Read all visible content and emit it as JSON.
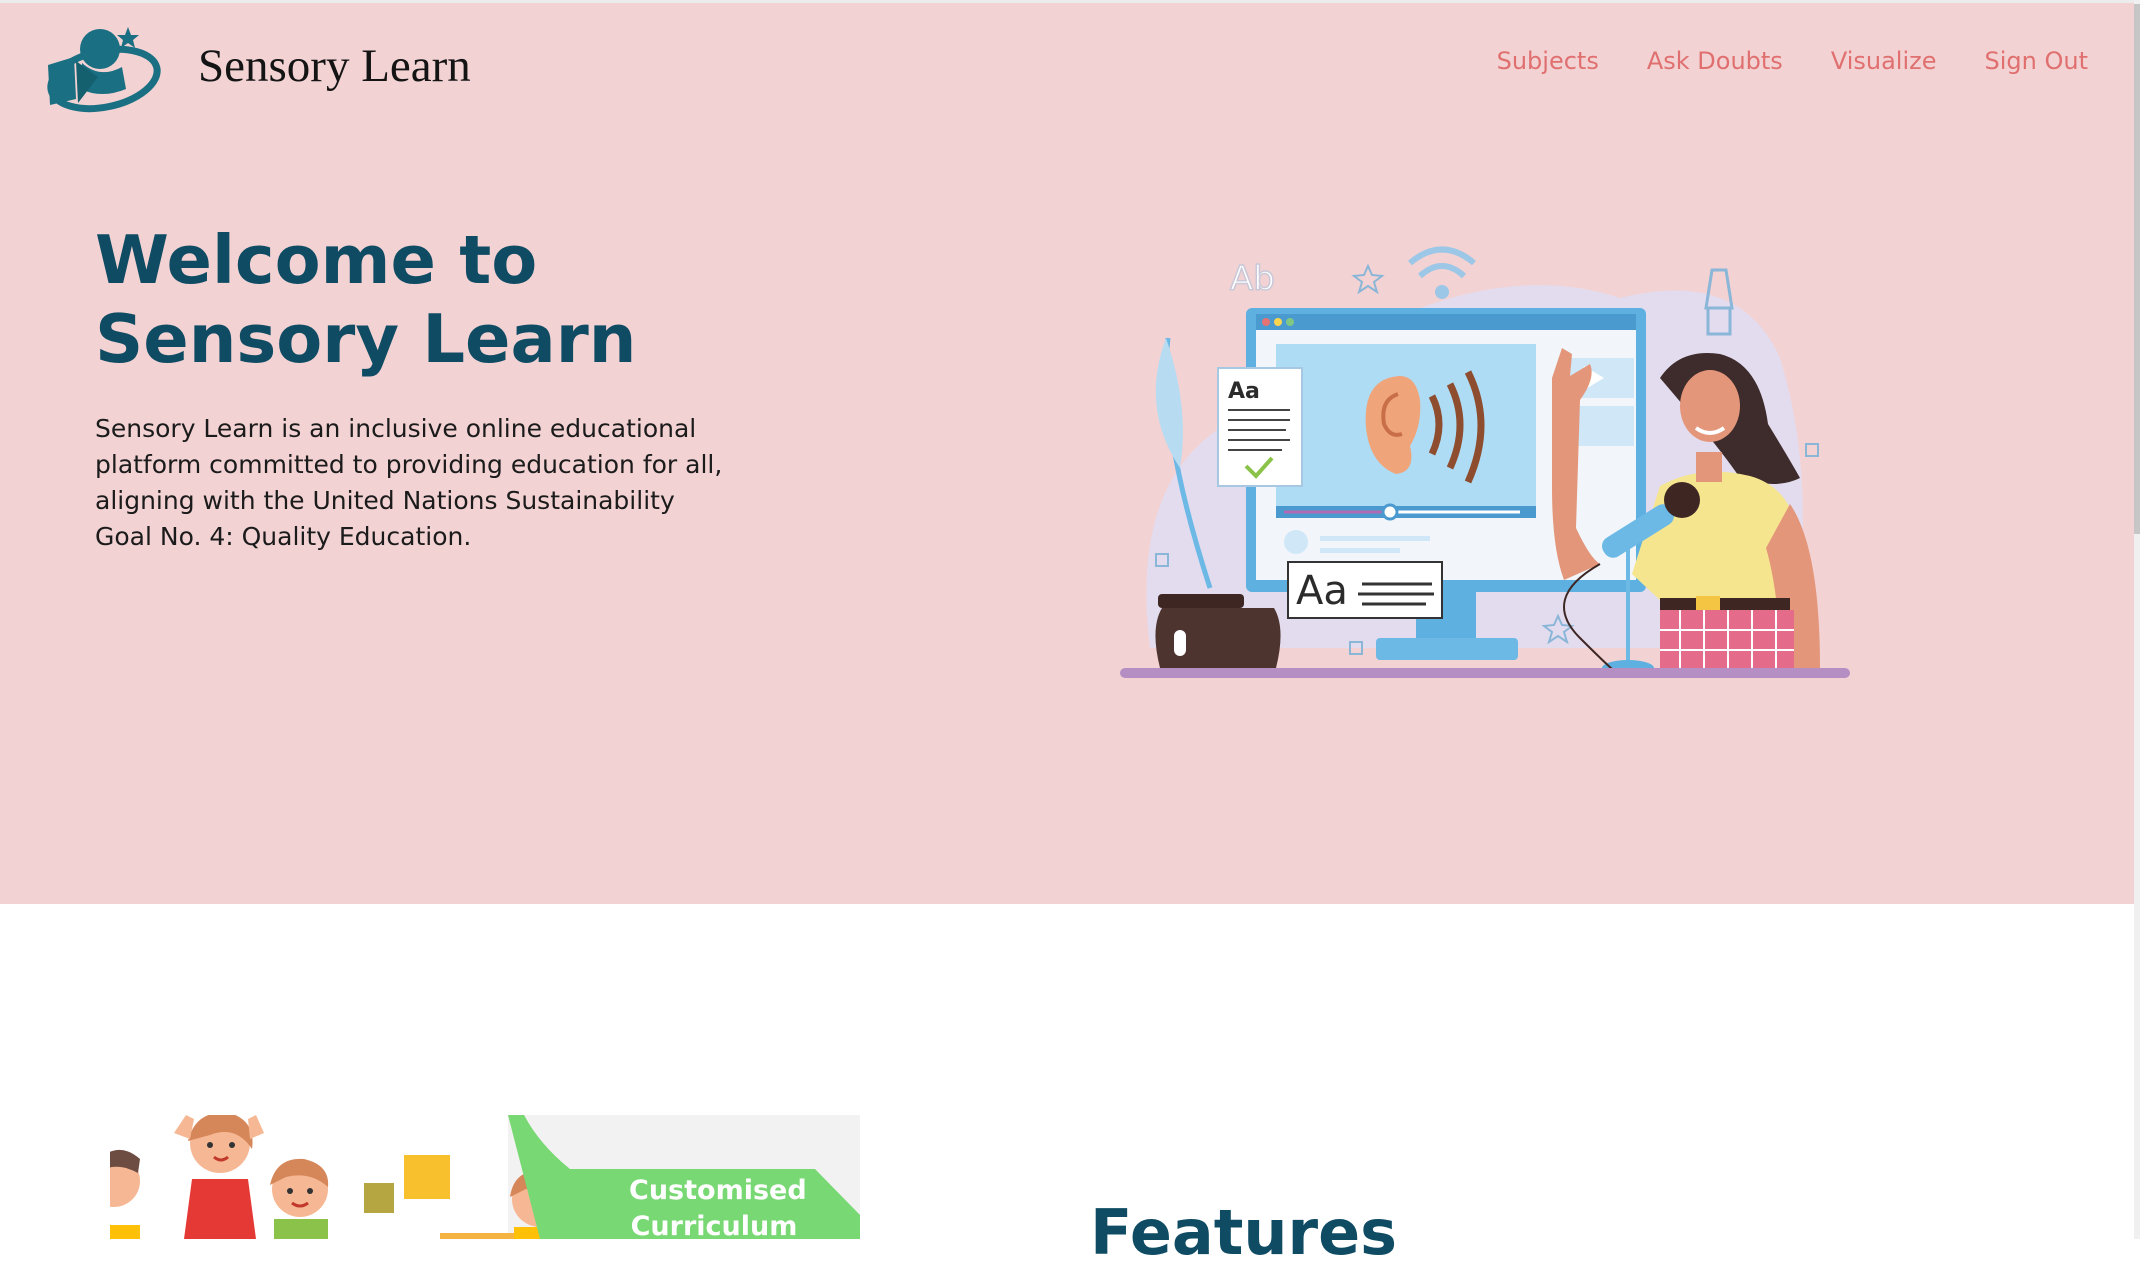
{
  "brand": {
    "name": "Sensory Learn"
  },
  "nav": {
    "items": [
      {
        "label": "Subjects"
      },
      {
        "label": "Ask Doubts"
      },
      {
        "label": "Visualize"
      },
      {
        "label": "Sign Out"
      }
    ]
  },
  "hero": {
    "title": "Welcome to Sensory Learn",
    "description": "Sensory Learn is an inclusive online educational platform committed to providing education for all, aligning with the United Nations Sustainability Goal No. 4: Quality Education.",
    "illustration": {
      "card_label": "Aa",
      "caption_label": "Aa",
      "watermark_label": "Ab"
    }
  },
  "features": {
    "banner_badge_line1": "Customised",
    "banner_badge_line2": "Curriculum",
    "heading": "Features"
  },
  "colors": {
    "hero_background": "#f2d2d3",
    "nav_link": "#e0706f",
    "heading": "#0f4c63",
    "badge": "#78d873",
    "accent_blue": "#6cb9e6"
  }
}
